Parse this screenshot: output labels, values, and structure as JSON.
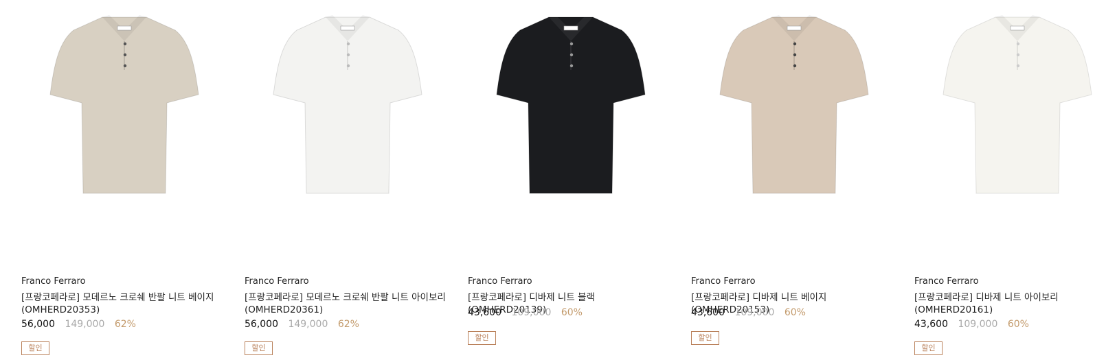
{
  "products": [
    {
      "brand": "Franco Ferraro",
      "name": "[프랑코페라로] 모데르노 크로쉐 반팔 니트 베이지 (OMHERD20353)",
      "sale_price": "56,000",
      "original_price": "149,000",
      "discount": "62%",
      "badge": "할인",
      "image": "beige-crochet-polo",
      "color": "#d8d0c2"
    },
    {
      "brand": "Franco Ferraro",
      "name": "[프랑코페라로] 모데르노 크로쉐 반팔 니트 아이보리 (OMHERD20361)",
      "sale_price": "56,000",
      "original_price": "149,000",
      "discount": "62%",
      "badge": "할인",
      "image": "ivory-crochet-polo",
      "color": "#f3f3f1"
    },
    {
      "brand": "Franco Ferraro",
      "name": "[프랑코페라로] 디바제 니트 블랙 (OMHERD20139)",
      "sale_price": "43,600",
      "original_price": "109,000",
      "discount": "60%",
      "badge": "할인",
      "image": "black-knit-polo",
      "color": "#1b1c1f"
    },
    {
      "brand": "Franco Ferraro",
      "name": "[프랑코페라로] 디바제 니트 베이지 (OMHERD20153)",
      "sale_price": "43,600",
      "original_price": "109,000",
      "discount": "60%",
      "badge": "할인",
      "image": "beige-knit-polo",
      "color": "#d9c9b8"
    },
    {
      "brand": "Franco Ferraro",
      "name": "[프랑코페라로] 디바제 니트 아이보리 (OMHERD20161)",
      "sale_price": "43,600",
      "original_price": "109,000",
      "discount": "60%",
      "badge": "할인",
      "image": "ivory-knit-polo",
      "color": "#f5f4ef"
    }
  ]
}
